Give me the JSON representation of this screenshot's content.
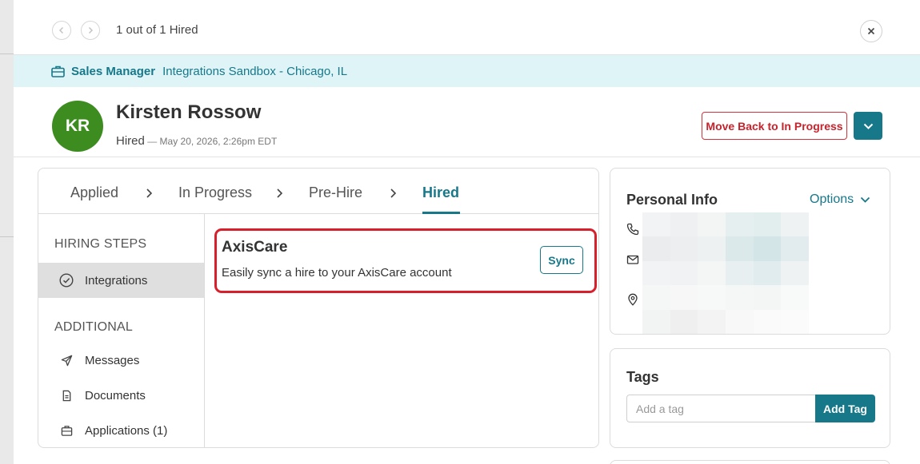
{
  "topbar": {
    "counter": "1 out of 1 Hired"
  },
  "job": {
    "title": "Sales Manager",
    "location": "Integrations Sandbox - Chicago, IL"
  },
  "candidate": {
    "initials": "KR",
    "name": "Kirsten Rossow",
    "status": "Hired",
    "status_separator": " — ",
    "status_date": "May 20, 2026, 2:26pm EDT",
    "move_back_label": "Move Back to In Progress"
  },
  "stages": [
    "Applied",
    "In Progress",
    "Pre-Hire",
    "Hired"
  ],
  "active_stage": "Hired",
  "sidebar": {
    "hiring_steps_title": "HIRING STEPS",
    "hiring_steps": [
      {
        "label": "Integrations",
        "icon": "check-circle-icon"
      }
    ],
    "additional_title": "ADDITIONAL",
    "additional": [
      {
        "label": "Messages",
        "icon": "paper-plane-icon"
      },
      {
        "label": "Documents",
        "icon": "document-icon"
      },
      {
        "label": "Applications (1)",
        "icon": "briefcase-icon"
      }
    ]
  },
  "integration": {
    "name": "AxisCare",
    "description": "Easily sync a hire to your AxisCare account",
    "sync_label": "Sync"
  },
  "personal_info": {
    "title": "Personal Info",
    "options_label": "Options"
  },
  "tags": {
    "title": "Tags",
    "placeholder": "Add a tag",
    "add_label": "Add Tag"
  },
  "colors": {
    "accent": "#17788a",
    "banner_bg": "#dff4f7",
    "avatar_bg": "#3d8c1f",
    "danger": "#d2333a",
    "highlight_border": "#d8202c"
  }
}
